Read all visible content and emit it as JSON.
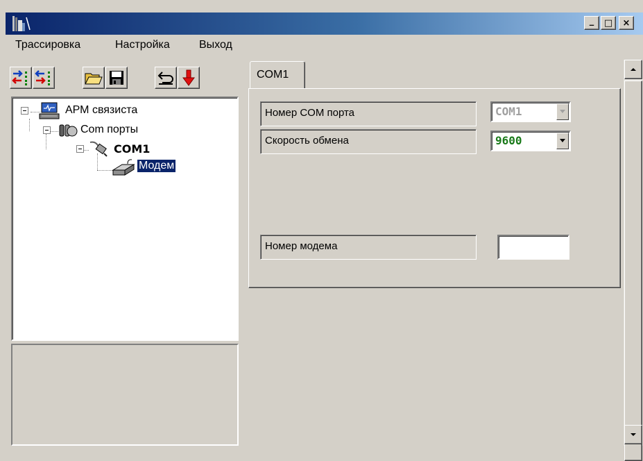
{
  "window": {
    "title": "",
    "title_gradient": [
      "#0a246a",
      "#a6caf0"
    ],
    "controls": {
      "minimize": "_",
      "maximize": "□",
      "close": "×"
    }
  },
  "menu": {
    "items": [
      {
        "label": "Трассировка"
      },
      {
        "label": "Настройка"
      },
      {
        "label": "Выход"
      }
    ]
  },
  "toolbar": {
    "buttons": [
      {
        "icon": "connect-in-icon"
      },
      {
        "icon": "connect-out-icon"
      },
      {
        "icon": "open-folder-icon"
      },
      {
        "icon": "save-disk-icon"
      },
      {
        "icon": "undo-icon"
      },
      {
        "icon": "download-arrow-icon"
      }
    ]
  },
  "tree": {
    "nodes": [
      {
        "label": "АРМ связиста",
        "icon": "workstation-icon",
        "expanded": true
      },
      {
        "label": "Com порты",
        "icon": "ports-icon",
        "expanded": true
      },
      {
        "label": "COM1",
        "icon": "serial-cable-icon",
        "expanded": true,
        "bold": true
      },
      {
        "label": "Модем",
        "icon": "modem-icon",
        "selected": true
      }
    ],
    "selection_color": "#0a246a"
  },
  "tabs": [
    {
      "label": "COM1",
      "active": true
    }
  ],
  "form": {
    "com_port": {
      "label": "Номер COM порта",
      "value": "COM1",
      "disabled": true
    },
    "baud_rate": {
      "label": "Скорость обмена",
      "value": "9600",
      "value_color": "#1a7a1a"
    },
    "modem_number": {
      "label": "Номер модема",
      "value": ""
    }
  }
}
